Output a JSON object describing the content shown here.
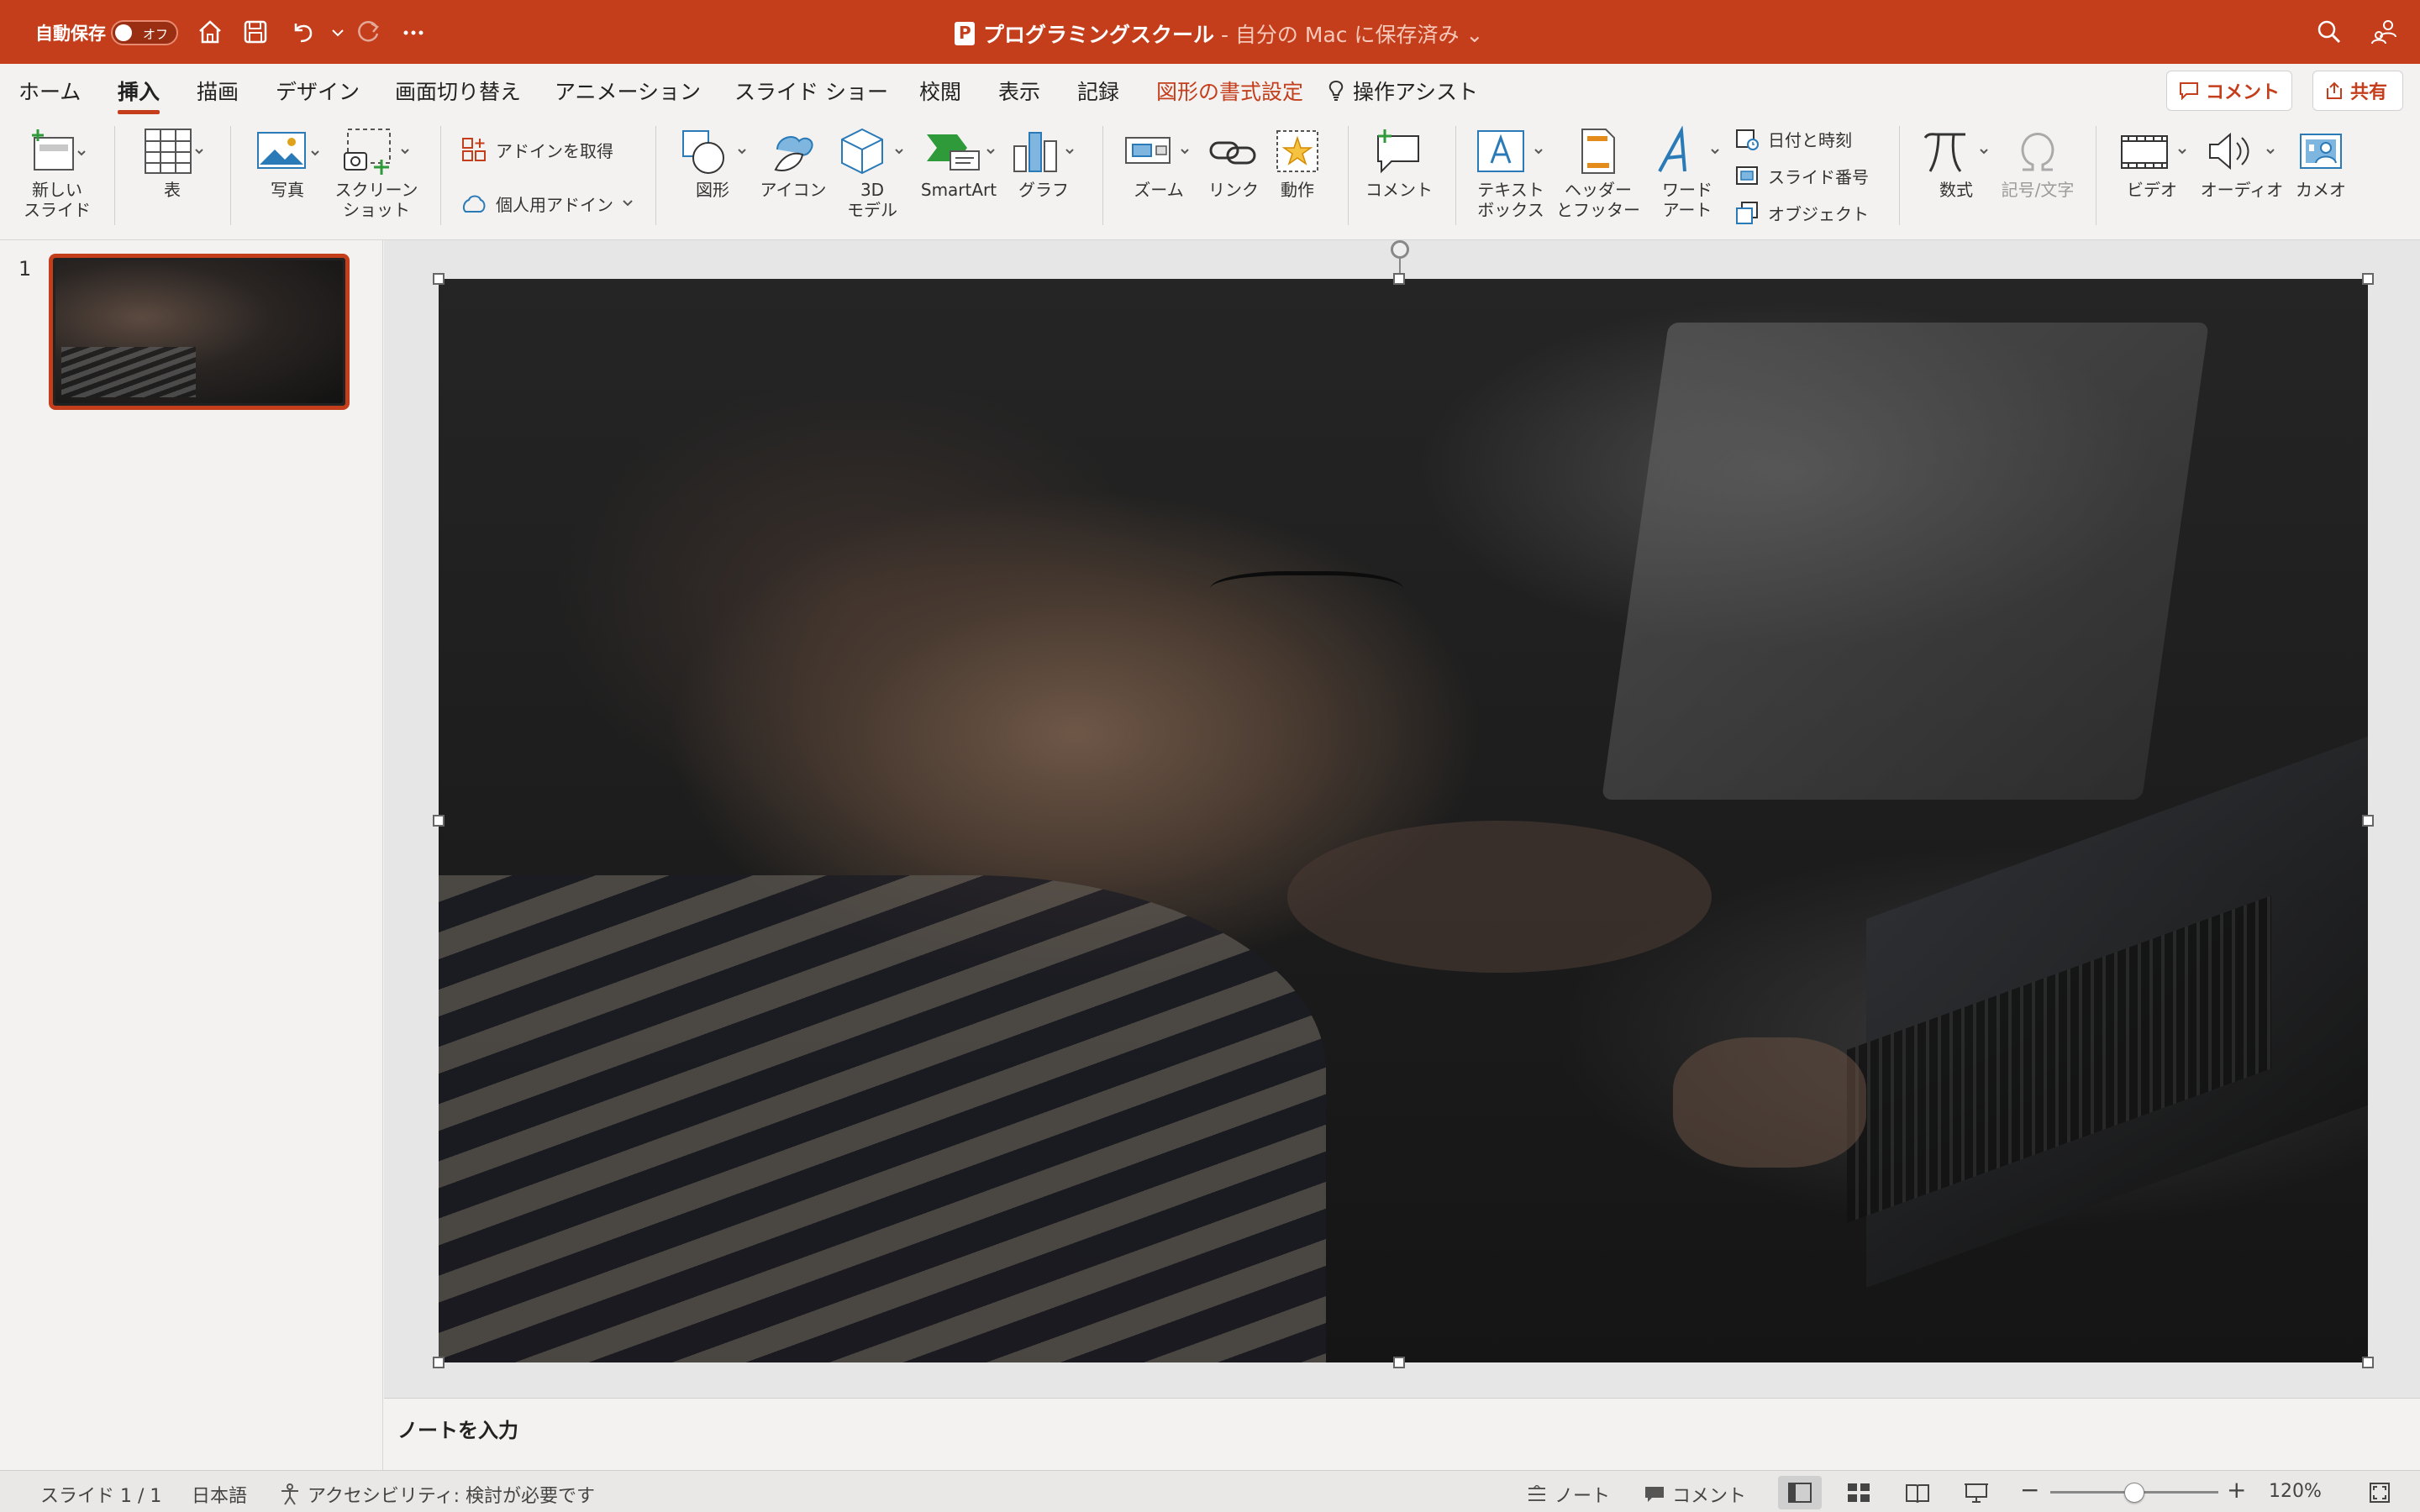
{
  "titlebar": {
    "autosave_label": "自動保存",
    "autosave_state": "オフ",
    "doc_name": "プログラミングスクール",
    "doc_status": " - 自分の Mac に保存済み",
    "caret": "⌄"
  },
  "tabs": [
    {
      "label": "ホーム"
    },
    {
      "label": "挿入"
    },
    {
      "label": "描画"
    },
    {
      "label": "デザイン"
    },
    {
      "label": "画面切り替え"
    },
    {
      "label": "アニメーション"
    },
    {
      "label": "スライド ショー"
    },
    {
      "label": "校閲"
    },
    {
      "label": "表示"
    },
    {
      "label": "記録"
    },
    {
      "label": "図形の書式設定"
    },
    {
      "label": "操作アシスト"
    }
  ],
  "active_tab": "挿入",
  "top_buttons": {
    "comment": "コメント",
    "share": "共有"
  },
  "ribbon": {
    "new_slide_1": "新しい",
    "new_slide_2": "スライド",
    "table": "表",
    "photo": "写真",
    "screenshot_1": "スクリーン",
    "screenshot_2": "ショット",
    "get_addins": "アドインを取得",
    "my_addins": "個人用アドイン",
    "shapes": "図形",
    "icons": "アイコン",
    "model3d_1": "3D",
    "model3d_2": "モデル",
    "smartart": "SmartArt",
    "chart": "グラフ",
    "zoom": "ズーム",
    "link": "リンク",
    "action": "動作",
    "comment": "コメント",
    "textbox_1": "テキスト",
    "textbox_2": "ボックス",
    "header_1": "ヘッダー",
    "header_2": "とフッター",
    "wordart_1": "ワード",
    "wordart_2": "アート",
    "datetime": "日付と時刻",
    "slide_number": "スライド番号",
    "object": "オブジェクト",
    "equation": "数式",
    "symbol": "記号/文字",
    "video": "ビデオ",
    "audio": "オーディオ",
    "cameo": "カメオ"
  },
  "thumbnails": [
    {
      "number": "1"
    }
  ],
  "notes_placeholder": "ノートを入力",
  "statusbar": {
    "slide_info": "スライド 1 / 1",
    "language": "日本語",
    "accessibility": "アクセシビリティ: 検討が必要です",
    "notes": "ノート",
    "comments": "コメント",
    "zoom": "120%"
  },
  "colors": {
    "accent": "#c43e1c",
    "ribbon_bg": "#f3f2f1"
  }
}
